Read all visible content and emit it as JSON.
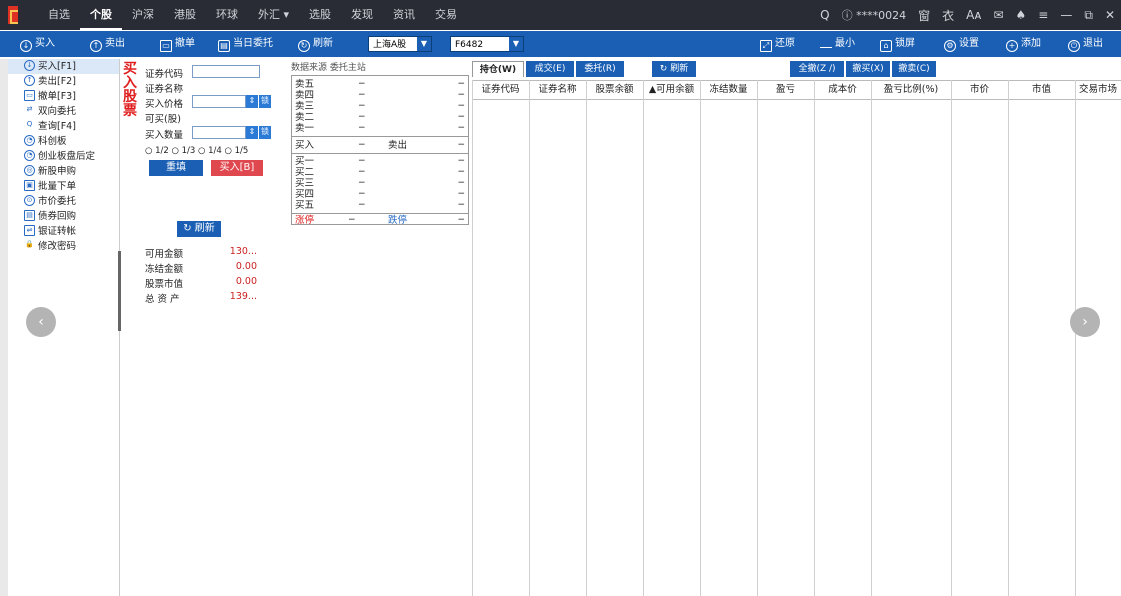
{
  "nav": [
    "自选",
    "个股",
    "沪深",
    "港股",
    "环球",
    "外汇 ▾",
    "选股",
    "发现",
    "资讯",
    "交易"
  ],
  "nav_active": "个股",
  "topright": {
    "search": "Q",
    "account": "****0024",
    "icons": [
      "窗",
      "衣",
      "Aᴀ",
      "✉",
      "♠",
      "≡",
      "—",
      "⧉",
      "✕"
    ]
  },
  "toolbar": {
    "buy": "买入",
    "sell": "卖出",
    "cancel": "撤单",
    "today": "当日委托",
    "refresh": "刷新",
    "market": "上海A股",
    "account": "F6482",
    "restore": "还原",
    "minimize": "最小",
    "lock": "锁屏",
    "settings": "设置",
    "add": "添加",
    "exit": "退出"
  },
  "sidebar": [
    {
      "icon": "↓",
      "label": "买入[F1]"
    },
    {
      "icon": "↑",
      "label": "卖出[F2]"
    },
    {
      "icon": "▭",
      "label": "撤单[F3]"
    },
    {
      "icon": "⇄",
      "label": "双向委托"
    },
    {
      "icon": "Q",
      "label": "查询[F4]"
    },
    {
      "icon": "◔",
      "label": "科创板"
    },
    {
      "icon": "◔",
      "label": "创业板盘后定"
    },
    {
      "icon": "◎",
      "label": "新股申购"
    },
    {
      "icon": "▣",
      "label": "批量下单"
    },
    {
      "icon": "⊙",
      "label": "市价委托"
    },
    {
      "icon": "▤",
      "label": "债券回购"
    },
    {
      "icon": "⇌",
      "label": "银证转帐"
    },
    {
      "icon": "🔒",
      "label": "修改密码"
    }
  ],
  "buy_panel": {
    "vtitle": [
      "买",
      "入",
      "股",
      "票"
    ],
    "code_label": "证券代码",
    "name_label": "证券名称",
    "price_label": "买入价格",
    "lock": "锁",
    "can_buy": "可买(股)",
    "qty_label": "买入数量",
    "ratios": "○ 1/2 ○ 1/3 ○ 1/4 ○ 1/5",
    "reset": "重填",
    "buy_btn": "买入[B]",
    "refresh": "刷新",
    "summary": [
      {
        "label": "可用金额",
        "value": "130..."
      },
      {
        "label": "冻结金额",
        "value": "0.00"
      },
      {
        "label": "股票市值",
        "value": "0.00"
      },
      {
        "label": "总 资 产",
        "value": "139..."
      }
    ]
  },
  "quote": {
    "header": "数据来源 委托主站",
    "sells": [
      "卖五",
      "卖四",
      "卖三",
      "卖二",
      "卖一"
    ],
    "buy_row": {
      "label": "买入",
      "dash": "−",
      "action": "卖出"
    },
    "buys": [
      "买一",
      "买二",
      "买三",
      "买四",
      "买五"
    ],
    "limits": {
      "up": "涨停",
      "dash": "−",
      "down": "跌停"
    },
    "dash": "−"
  },
  "tabs": {
    "hold": "持仓(W)",
    "deal": "成交(E)",
    "order": "委托(R)",
    "refresh": "刷新",
    "all": "全撤(Z /)",
    "cancel_buy": "撤买(X)",
    "cancel_sell": "撤卖(C)"
  },
  "columns": [
    "证券代码",
    "证券名称",
    "股票余额",
    "▲可用余额",
    "冻结数量",
    "盈亏",
    "成本价",
    "盈亏比例(%)",
    "市价",
    "市值",
    "交易市场"
  ],
  "nav_arrows": {
    "left": "‹",
    "right": "›"
  }
}
